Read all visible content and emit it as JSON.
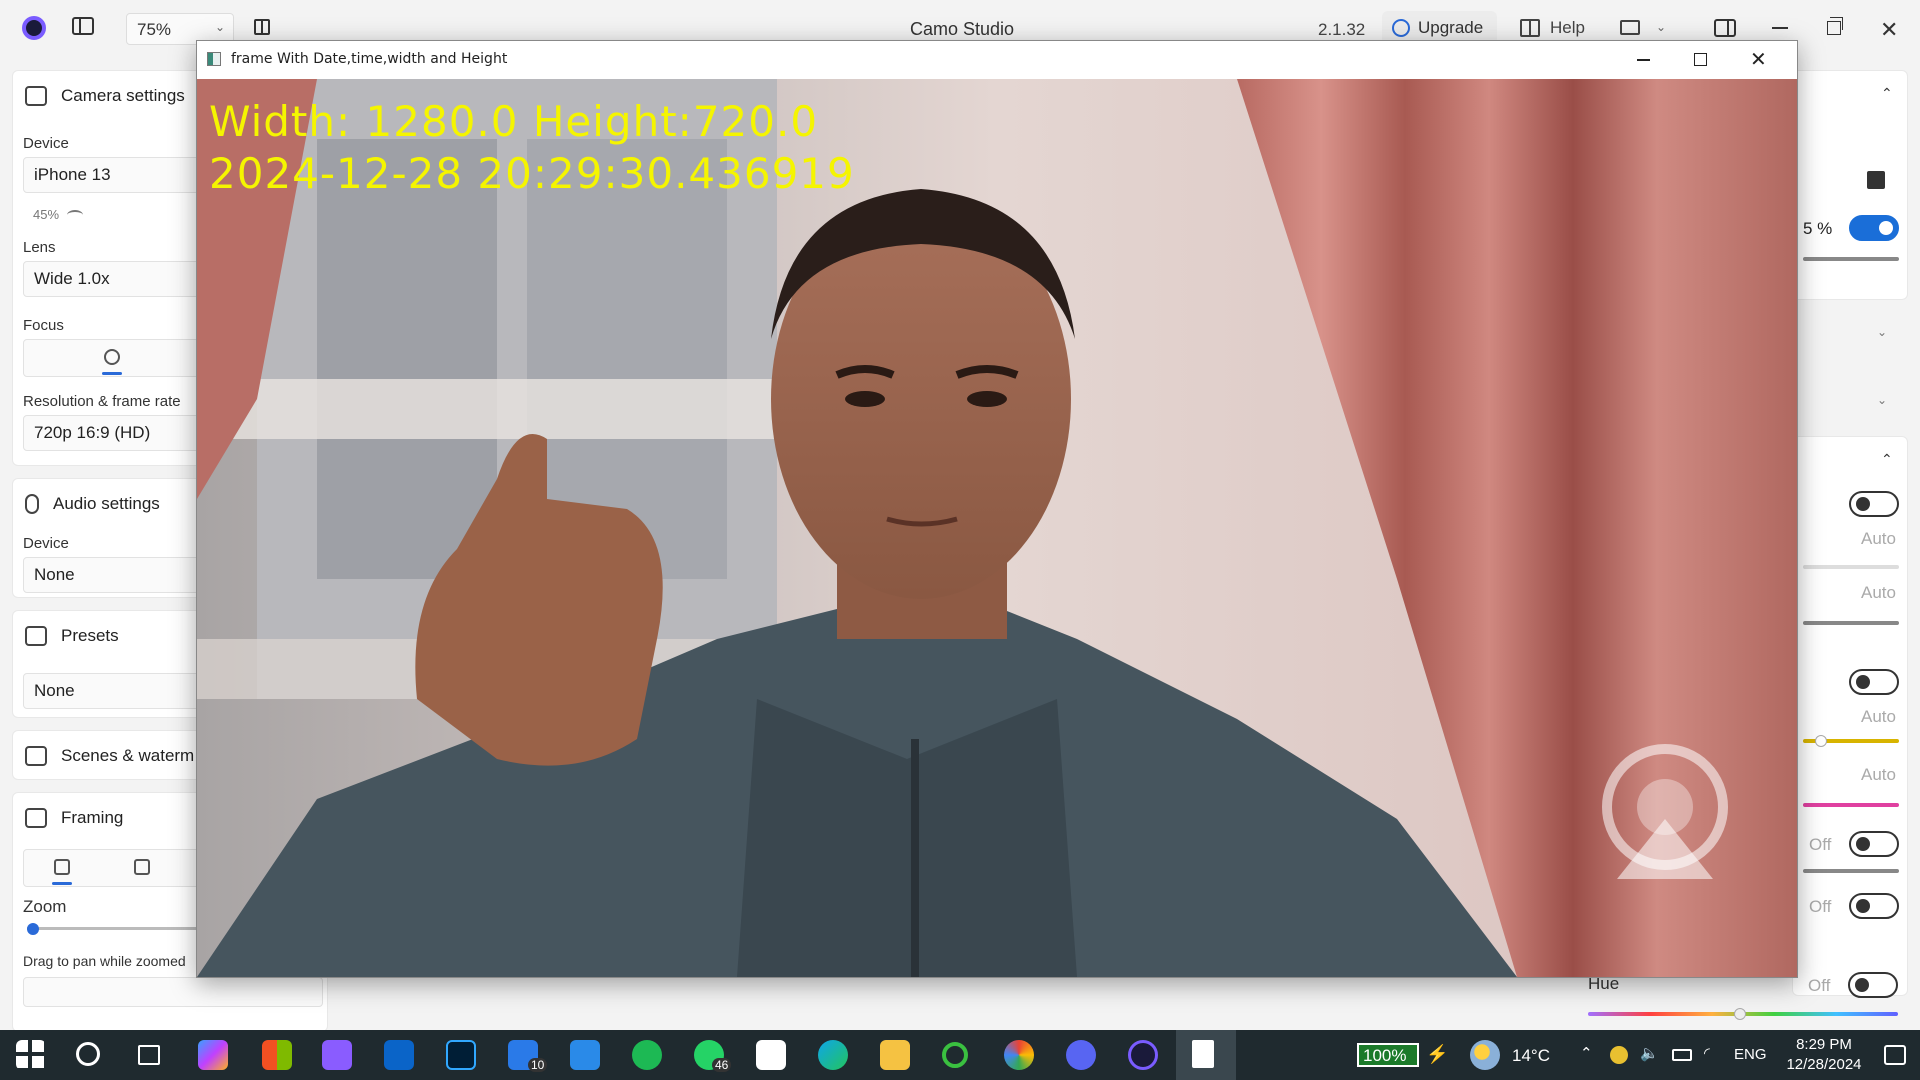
{
  "topbar": {
    "zoom": "75%",
    "app_title": "Camo Studio",
    "version": "2.1.32",
    "upgrade_label": "Upgrade",
    "help_label": "Help"
  },
  "left_panel": {
    "camera_settings": {
      "title": "Camera settings",
      "device_label": "Device",
      "device_value": "iPhone 13",
      "battery": "45%",
      "lens_label": "Lens",
      "lens_value": "Wide 1.0x",
      "focus_label": "Focus",
      "resolution_label": "Resolution & frame rate",
      "resolution_value": "720p 16:9 (HD)"
    },
    "audio_settings": {
      "title": "Audio settings",
      "device_label": "Device",
      "device_value": "None"
    },
    "presets": {
      "title": "Presets",
      "value": "None"
    },
    "scenes": {
      "title": "Scenes & waterm"
    },
    "framing": {
      "title": "Framing",
      "zoom_label": "Zoom",
      "pan_hint": "Drag to pan while zoomed"
    }
  },
  "right_panel": {
    "percent": "5 %",
    "auto_1": "Auto",
    "auto_2": "Auto",
    "auto_3": "Auto",
    "auto_4": "Auto",
    "off_1": "Off",
    "off_2": "Off",
    "off_3": "Off",
    "hue_label": "Hue"
  },
  "window": {
    "title": "frame With Date,time,width and Height",
    "overlay_line1": "Width: 1280.0 Height:720.0",
    "overlay_line2": "2024-12-28 20:29:30.436919"
  },
  "taskbar": {
    "battery": "100%",
    "weather": "14°C",
    "lang": "ENG",
    "time": "8:29 PM",
    "date": "12/28/2024",
    "badge_todo": "10",
    "badge_whatsapp": "46"
  },
  "colors": {
    "accent": "#1a6ed8",
    "overlay_text": "#f5f500",
    "taskbar": "#1f2a2f"
  }
}
